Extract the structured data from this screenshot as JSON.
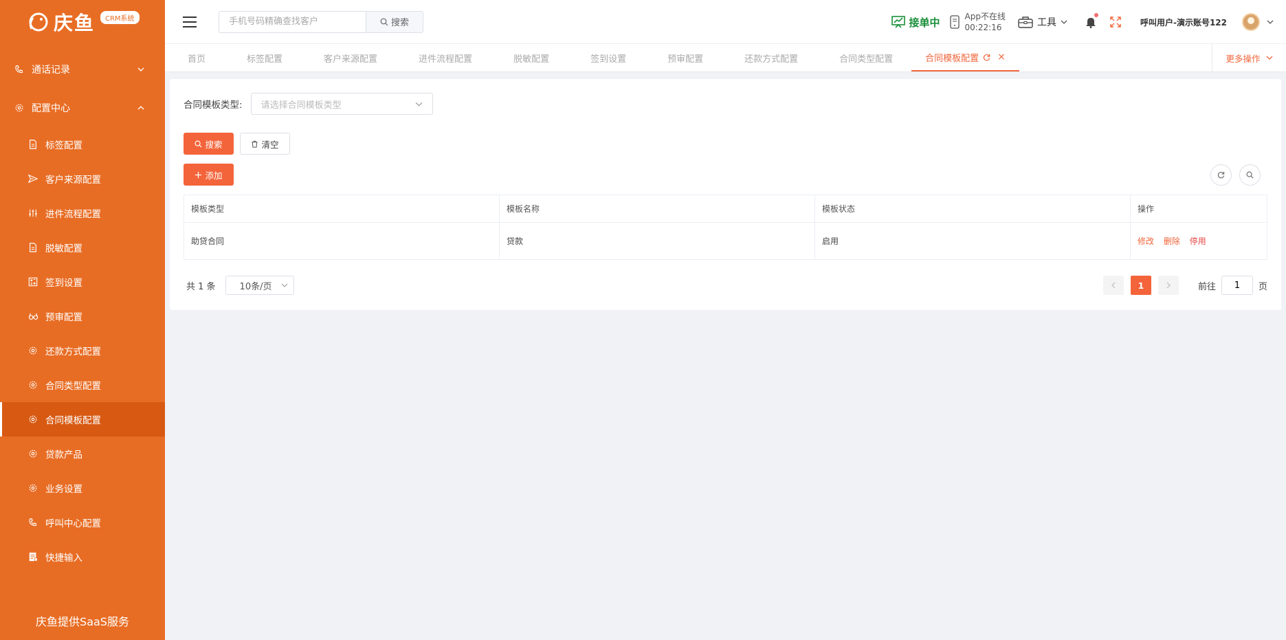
{
  "brand": {
    "name": "庆鱼",
    "badge": "CRM系统"
  },
  "sidebar": {
    "groups": [
      {
        "label": "通话记录",
        "icon": "phone-icon",
        "expanded": false
      },
      {
        "label": "配置中心",
        "icon": "gear-icon",
        "expanded": true
      }
    ],
    "items": [
      {
        "label": "标签配置",
        "icon": "document-icon"
      },
      {
        "label": "客户来源配置",
        "icon": "send-icon"
      },
      {
        "label": "进件流程配置",
        "icon": "sliders-icon"
      },
      {
        "label": "脱敏配置",
        "icon": "document-icon"
      },
      {
        "label": "签到设置",
        "icon": "qrcode-icon"
      },
      {
        "label": "预审配置",
        "icon": "glasses-icon"
      },
      {
        "label": "还款方式配置",
        "icon": "gear-icon"
      },
      {
        "label": "合同类型配置",
        "icon": "gear-icon"
      },
      {
        "label": "合同模板配置",
        "icon": "gear-icon",
        "active": true
      },
      {
        "label": "贷款产品",
        "icon": "gear-icon"
      },
      {
        "label": "业务设置",
        "icon": "gear-icon"
      },
      {
        "label": "呼叫中心配置",
        "icon": "phone-icon"
      },
      {
        "label": "快捷输入",
        "icon": "form-icon"
      }
    ],
    "footer": "庆鱼提供SaaS服务"
  },
  "header": {
    "search_placeholder": "手机号码精确查找客户",
    "search_button": "搜索",
    "accept_status": "接单中",
    "app_status": "App不在线",
    "app_timer": "00:22:16",
    "tools_label": "工具",
    "user_name": "呼叫用户-演示账号122"
  },
  "tabs": {
    "items": [
      "首页",
      "标签配置",
      "客户来源配置",
      "进件流程配置",
      "脱敏配置",
      "签到设置",
      "预审配置",
      "还款方式配置",
      "合同类型配置"
    ],
    "active": "合同模板配置",
    "more": "更多操作"
  },
  "filter": {
    "label": "合同模板类型:",
    "placeholder": "请选择合同模板类型"
  },
  "buttons": {
    "search": "搜索",
    "clear": "清空",
    "add": "添加"
  },
  "table": {
    "columns": [
      "模板类型",
      "模板名称",
      "模板状态",
      "操作"
    ],
    "rows": [
      {
        "type": "助贷合同",
        "name": "贷款",
        "status": "启用",
        "ops": [
          "修改",
          "删除",
          "停用"
        ]
      }
    ]
  },
  "pagination": {
    "total_text": "共 1 条",
    "page_size": "10条/页",
    "current_page": "1",
    "goto_prefix": "前往",
    "goto_value": "1",
    "goto_suffix": "页"
  },
  "colors": {
    "sidebar": "#e86d24",
    "sidebar_active": "#d85a12",
    "accent": "#f4643a",
    "accept_green": "#1a8f3a"
  }
}
